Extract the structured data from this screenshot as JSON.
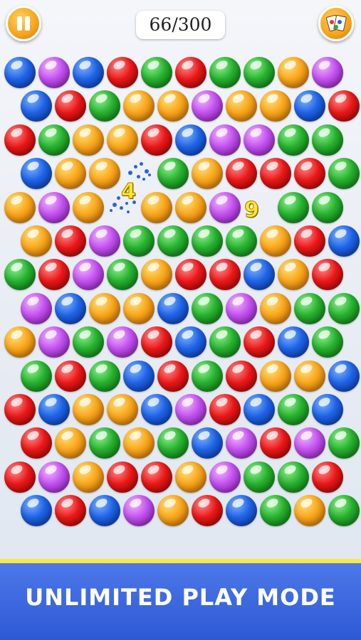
{
  "hud": {
    "counter_text": "66/300",
    "pause_icon": "pause-icon",
    "cards_icon": "cards-icon"
  },
  "score_popups": [
    "4",
    "9"
  ],
  "bubble_rows": [
    [
      "blue",
      "purple",
      "blue",
      "red",
      "green",
      "red",
      "green",
      "green",
      "orange",
      "purple"
    ],
    [
      "blue",
      "red",
      "green",
      "orange",
      "orange",
      "purple",
      "orange",
      "orange",
      "blue",
      "red"
    ],
    [
      "red",
      "green",
      "orange",
      "orange",
      "red",
      "blue",
      "purple",
      "purple",
      "green",
      "green"
    ],
    [
      "blue",
      "orange",
      "orange",
      "",
      "green",
      "orange",
      "red",
      "red",
      "red",
      "green"
    ],
    [
      "orange",
      "purple",
      "orange",
      "",
      "orange",
      "orange",
      "purple",
      "",
      "green",
      "green"
    ],
    [
      "orange",
      "red",
      "purple",
      "green",
      "green",
      "green",
      "green",
      "orange",
      "red",
      "blue"
    ],
    [
      "green",
      "red",
      "purple",
      "green",
      "orange",
      "red",
      "red",
      "blue",
      "orange",
      "red"
    ],
    [
      "purple",
      "blue",
      "orange",
      "orange",
      "blue",
      "green",
      "purple",
      "orange",
      "green",
      "green"
    ],
    [
      "orange",
      "purple",
      "green",
      "purple",
      "red",
      "blue",
      "green",
      "red",
      "blue",
      "green"
    ],
    [
      "green",
      "red",
      "green",
      "blue",
      "red",
      "green",
      "red",
      "orange",
      "orange",
      "blue"
    ],
    [
      "red",
      "blue",
      "orange",
      "orange",
      "blue",
      "purple",
      "red",
      "blue",
      "green",
      "blue"
    ],
    [
      "red",
      "orange",
      "green",
      "orange",
      "green",
      "blue",
      "purple",
      "red",
      "purple",
      "green"
    ],
    [
      "red",
      "purple",
      "orange",
      "red",
      "red",
      "orange",
      "purple",
      "green",
      "green",
      "red"
    ],
    [
      "blue",
      "red",
      "blue",
      "purple",
      "orange",
      "red",
      "blue",
      "green",
      "orange",
      "green"
    ]
  ],
  "footer": {
    "mode_label": "UNLIMITED PLAY MODE"
  },
  "colors": {
    "footer_bg": "#2d59d6",
    "footer_stripe": "#f6e94b",
    "popup_text": "#ffe928"
  }
}
